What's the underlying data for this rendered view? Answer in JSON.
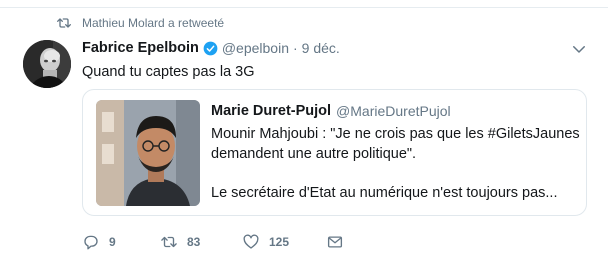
{
  "retweet_context": {
    "text": "Mathieu Molard a retweeté",
    "icon": "retweet-icon"
  },
  "tweet": {
    "author_name": "Fabrice Epelboin",
    "verified": true,
    "handle": "@epelboin",
    "separator": "·",
    "time": "9 déc.",
    "text": "Quand tu captes pas la 3G",
    "avatar_icon": "profile-photo"
  },
  "quoted_tweet": {
    "author_name": "Marie Duret-Pujol",
    "handle": "@MarieDuretPujol",
    "line1": "Mounir Mahjoubi : \"Je ne crois pas que les #GiletsJaunes",
    "line2": "demandent une autre politique\".",
    "line3": "Le secrétaire d'Etat au numérique n'est toujours pas...",
    "image_icon": "portrait-photo"
  },
  "actions": {
    "reply_count": "9",
    "retweet_count": "83",
    "like_count": "125"
  },
  "colors": {
    "text": "#14171a",
    "secondary": "#657786",
    "verified": "#1da1f2",
    "border": "#e1e8ed"
  }
}
